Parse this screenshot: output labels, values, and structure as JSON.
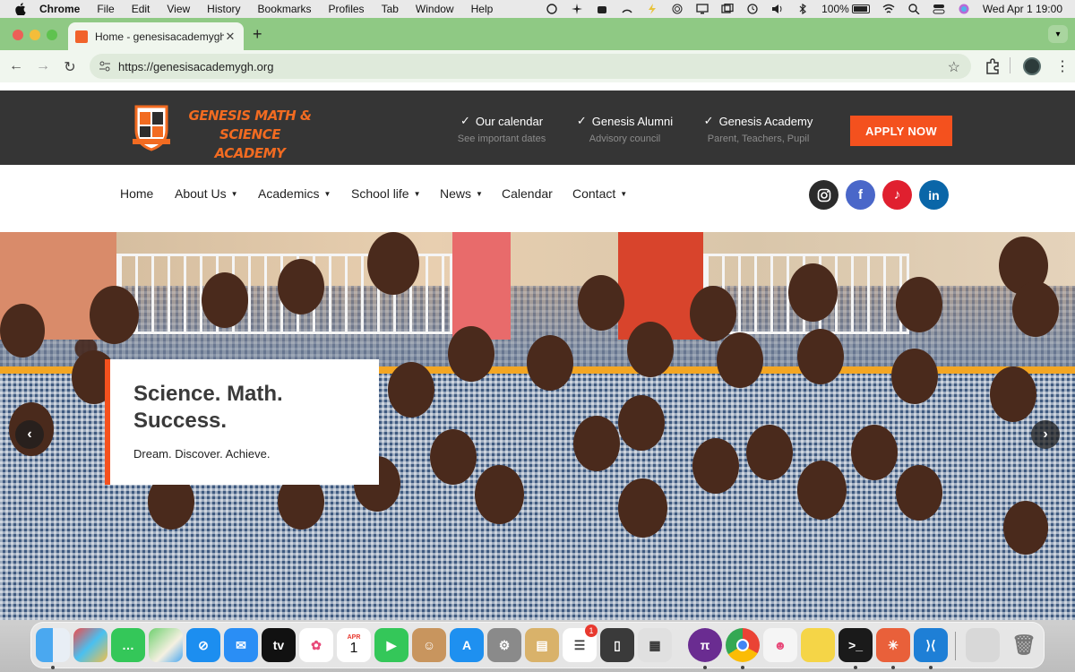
{
  "menubar": {
    "app": "Chrome",
    "items": [
      "File",
      "Edit",
      "View",
      "History",
      "Bookmarks",
      "Profiles",
      "Tab",
      "Window",
      "Help"
    ],
    "battery": "100%",
    "datetime": "Wed Apr 1  19:00"
  },
  "browser": {
    "tab_title": "Home - genesisacademygh.o",
    "url": "https://genesisacademygh.org"
  },
  "site": {
    "logo_text_line1": "GENESIS MATH & SCIENCE",
    "logo_text_line2": "ACADEMY",
    "info": [
      {
        "title": "Our calendar",
        "sub": "See important dates"
      },
      {
        "title": "Genesis Alumni",
        "sub": "Advisory council"
      },
      {
        "title": "Genesis Academy",
        "sub": "Parent, Teachers, Pupil"
      }
    ],
    "apply_label": "APPLY NOW",
    "nav": [
      {
        "label": "Home",
        "caret": false
      },
      {
        "label": "About Us",
        "caret": true
      },
      {
        "label": "Academics",
        "caret": true
      },
      {
        "label": "School life",
        "caret": true
      },
      {
        "label": "News",
        "caret": true
      },
      {
        "label": "Calendar",
        "caret": false
      },
      {
        "label": "Contact",
        "caret": true
      }
    ],
    "social": [
      {
        "name": "instagram-icon",
        "color": "#2b2b2b"
      },
      {
        "name": "facebook-icon",
        "color": "#4a67c9"
      },
      {
        "name": "tiktok-icon",
        "color": "#e0202f"
      },
      {
        "name": "linkedin-icon",
        "color": "#0a66a8"
      }
    ],
    "hero": {
      "headline_line1": "Science. Math.",
      "headline_line2": "Success.",
      "tagline": "Dream. Discover. Achieve."
    }
  },
  "dock": {
    "calendar_month": "APR",
    "calendar_day": "1",
    "reminders_badge": "1",
    "apps": [
      "finder-icon",
      "launchpad-icon",
      "messages-icon",
      "maps-icon",
      "safari-icon",
      "mail-icon",
      "apple-tv-icon",
      "photos-icon",
      "calendar-icon",
      "facetime-icon",
      "contacts-icon",
      "app-store-icon",
      "system-settings-icon",
      "archive-utility-icon",
      "reminders-icon",
      "iphone-mirroring-icon",
      "calculator-icon",
      "pi-network-icon",
      "chrome-icon",
      "robot-app-icon",
      "notes-icon",
      "terminal-icon",
      "claude-icon",
      "vscode-icon",
      "downloads-stack-icon",
      "trash-icon"
    ]
  },
  "colors": {
    "accent": "#f4511e",
    "header_dark": "#353535",
    "tab_green": "#8fc984"
  }
}
